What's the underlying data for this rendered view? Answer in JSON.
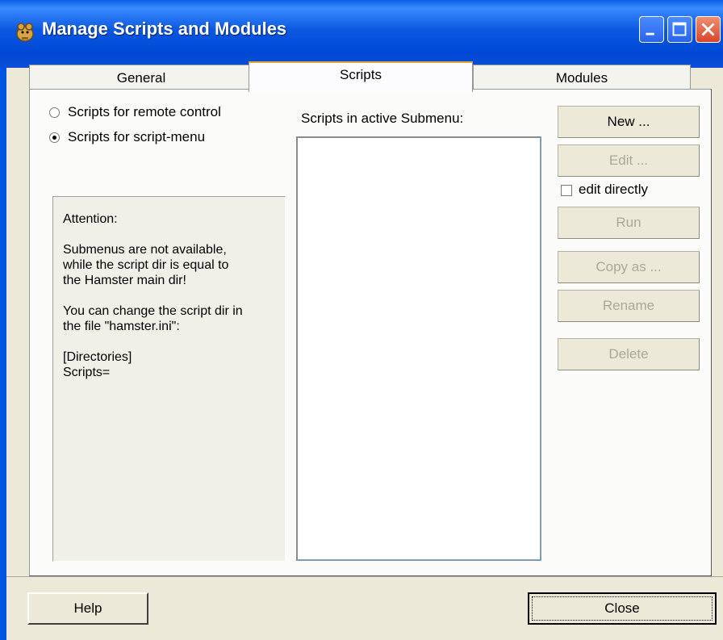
{
  "window": {
    "title": "Manage Scripts and Modules"
  },
  "tabs": [
    {
      "label": "General",
      "active": false
    },
    {
      "label": "Scripts",
      "active": true
    },
    {
      "label": "Modules",
      "active": false
    }
  ],
  "scripts_tab": {
    "radio_remote": {
      "label": "Scripts for remote control",
      "selected": false
    },
    "radio_menu": {
      "label": "Scripts for script-menu",
      "selected": true
    },
    "attention_text": "Attention:\n\nSubmenus are not available,\nwhile the script dir is equal to\nthe Hamster main dir!\n\nYou can change the script dir in\nthe file \"hamster.ini\":\n\n[Directories]\nScripts=",
    "list_label": "Scripts in active Submenu:",
    "list_items": [],
    "buttons": {
      "new": "New ...",
      "edit": "Edit ...",
      "run": "Run",
      "copy_as": "Copy as ...",
      "rename": "Rename",
      "delete": "Delete"
    },
    "edit_directly": {
      "label": "edit directly",
      "checked": false
    }
  },
  "footer": {
    "help": "Help",
    "close": "Close"
  },
  "colors": {
    "titlebar": "#0054e3",
    "dialog_bg": "#ece9d8",
    "disabled_text": "#aca899"
  }
}
